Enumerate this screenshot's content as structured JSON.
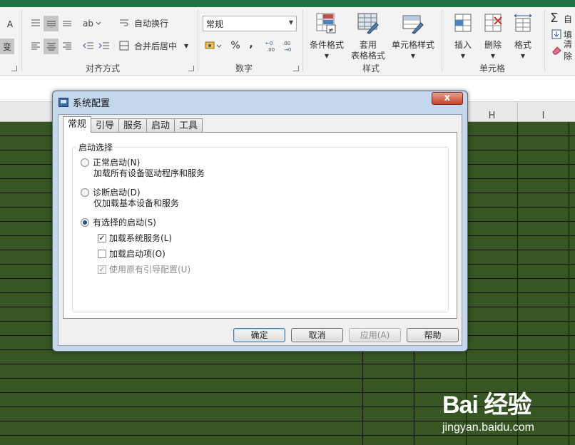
{
  "colors": {
    "excel_green": "#217346",
    "sheet_fill": "#375623",
    "dialog_frame": "#c4d7ec"
  },
  "ribbon": {
    "alignment": {
      "wrap_text_label": "自动换行",
      "merge_center_label": "合并后居中",
      "group_label": "对齐方式"
    },
    "number": {
      "format_value": "常规",
      "percent_symbol": "%",
      "comma_symbol": ",",
      "group_label": "数字"
    },
    "styles": {
      "conditional_format_label": "条件格式",
      "table_format_line1": "套用",
      "table_format_line2": "表格格式",
      "cell_styles_label": "单元格样式",
      "group_label": "样式"
    },
    "cells": {
      "insert_label": "插入",
      "delete_label": "删除",
      "format_label": "格式",
      "group_label": "单元格"
    },
    "editing": {
      "autosum_label": "自",
      "fill_label": "填",
      "clear_label": "清除"
    }
  },
  "grid": {
    "columns": [
      "H",
      "I"
    ]
  },
  "dialog": {
    "title": "系统配置",
    "close_label": "x",
    "tabs": [
      "常规",
      "引导",
      "服务",
      "启动",
      "工具"
    ],
    "active_tab": "常规",
    "startup_selection": {
      "legend": "启动选择",
      "options": [
        {
          "label": "正常启动(N)",
          "description": "加载所有设备驱动程序和服务",
          "selected": false
        },
        {
          "label": "诊断启动(D)",
          "description": "仅加载基本设备和服务",
          "selected": false
        },
        {
          "label": "有选择的启动(S)",
          "selected": true
        }
      ],
      "sub_options": [
        {
          "label": "加载系统服务(L)",
          "checked": true,
          "enabled": true
        },
        {
          "label": "加载启动项(O)",
          "checked": false,
          "enabled": true
        },
        {
          "label": "使用原有引导配置(U)",
          "checked": true,
          "enabled": false
        }
      ]
    },
    "buttons": {
      "ok": "确定",
      "cancel": "取消",
      "apply": "应用(A)",
      "help": "帮助"
    }
  },
  "watermark": {
    "logo_text": "Bai 经验",
    "site": "jingyan.baidu.com"
  }
}
